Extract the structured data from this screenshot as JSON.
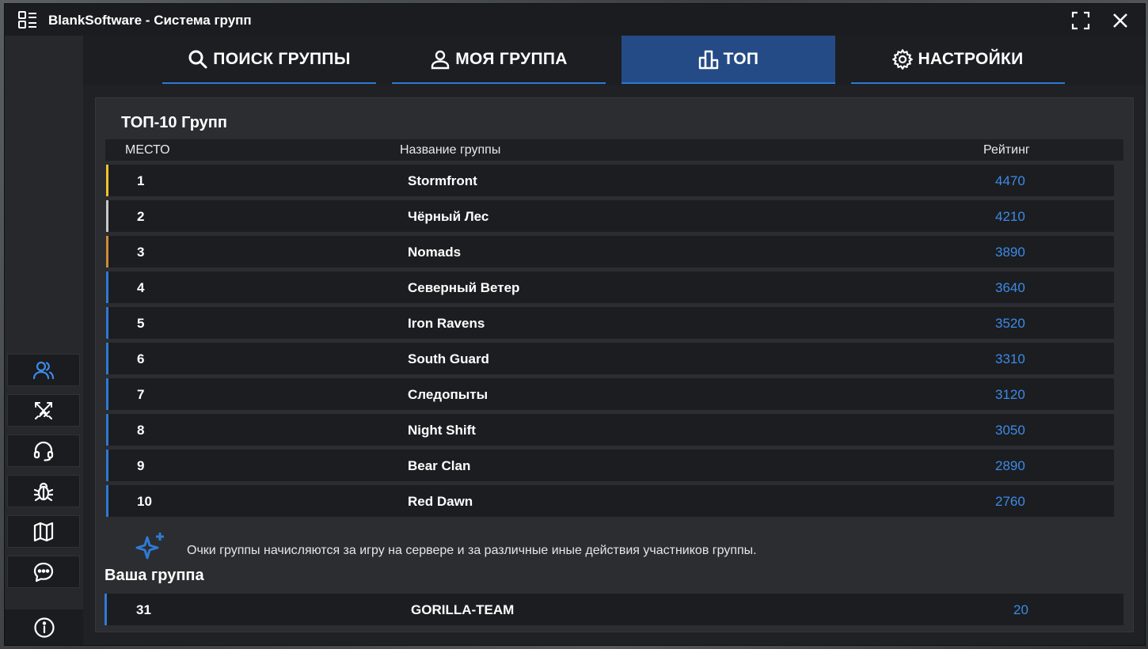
{
  "window": {
    "title": "BlankSoftware - Система групп",
    "icons": {
      "app": "app-grid-icon",
      "maximize": "maximize-icon",
      "close": "close-icon"
    }
  },
  "tabs": [
    {
      "label": "ПОИСК ГРУППЫ",
      "icon": "search-icon",
      "active": false
    },
    {
      "label": "МОЯ ГРУППА",
      "icon": "user-icon",
      "active": false
    },
    {
      "label": "ТОП",
      "icon": "bar-chart-icon",
      "active": true
    },
    {
      "label": "НАСТРОЙКИ",
      "icon": "gear-icon",
      "active": false
    }
  ],
  "sidebar": {
    "items": [
      {
        "name": "group-icon",
        "active": true
      },
      {
        "name": "crossed-swords-icon",
        "active": false
      },
      {
        "name": "headset-icon",
        "active": false
      },
      {
        "name": "bug-icon",
        "active": false
      },
      {
        "name": "map-icon",
        "active": false
      },
      {
        "name": "chat-icon",
        "active": false
      }
    ],
    "info_icon": "info-icon"
  },
  "top": {
    "title": "ТОП-10 Групп",
    "columns": {
      "place": "МЕСТО",
      "name": "Название группы",
      "rating": "Рейтинг"
    },
    "rows": [
      {
        "place": "1",
        "name": "Stormfront",
        "rating": "4470"
      },
      {
        "place": "2",
        "name": "Чёрный Лес",
        "rating": "4210"
      },
      {
        "place": "3",
        "name": "Nomads",
        "rating": "3890"
      },
      {
        "place": "4",
        "name": "Северный Ветер",
        "rating": "3640"
      },
      {
        "place": "5",
        "name": "Iron Ravens",
        "rating": "3520"
      },
      {
        "place": "6",
        "name": "South Guard",
        "rating": "3310"
      },
      {
        "place": "7",
        "name": "Следопыты",
        "rating": "3120"
      },
      {
        "place": "8",
        "name": "Night Shift",
        "rating": "3050"
      },
      {
        "place": "9",
        "name": "Bear Clan",
        "rating": "2890"
      },
      {
        "place": "10",
        "name": "Red Dawn",
        "rating": "2760"
      }
    ],
    "note": "Очки группы начисляются за игру на сервере и за различные иные действия участников группы.",
    "note_icon": "sparkles-icon"
  },
  "my_group": {
    "title": "Ваша группа",
    "place": "31",
    "name": "GORILLA-TEAM",
    "rating": "20"
  },
  "colors": {
    "accent": "#2f7ad6",
    "active_tab": "#244b86",
    "rating": "#3d8ae6",
    "gold": "#f2c230",
    "silver": "#c8c8c8",
    "bronze": "#d08a3a"
  }
}
